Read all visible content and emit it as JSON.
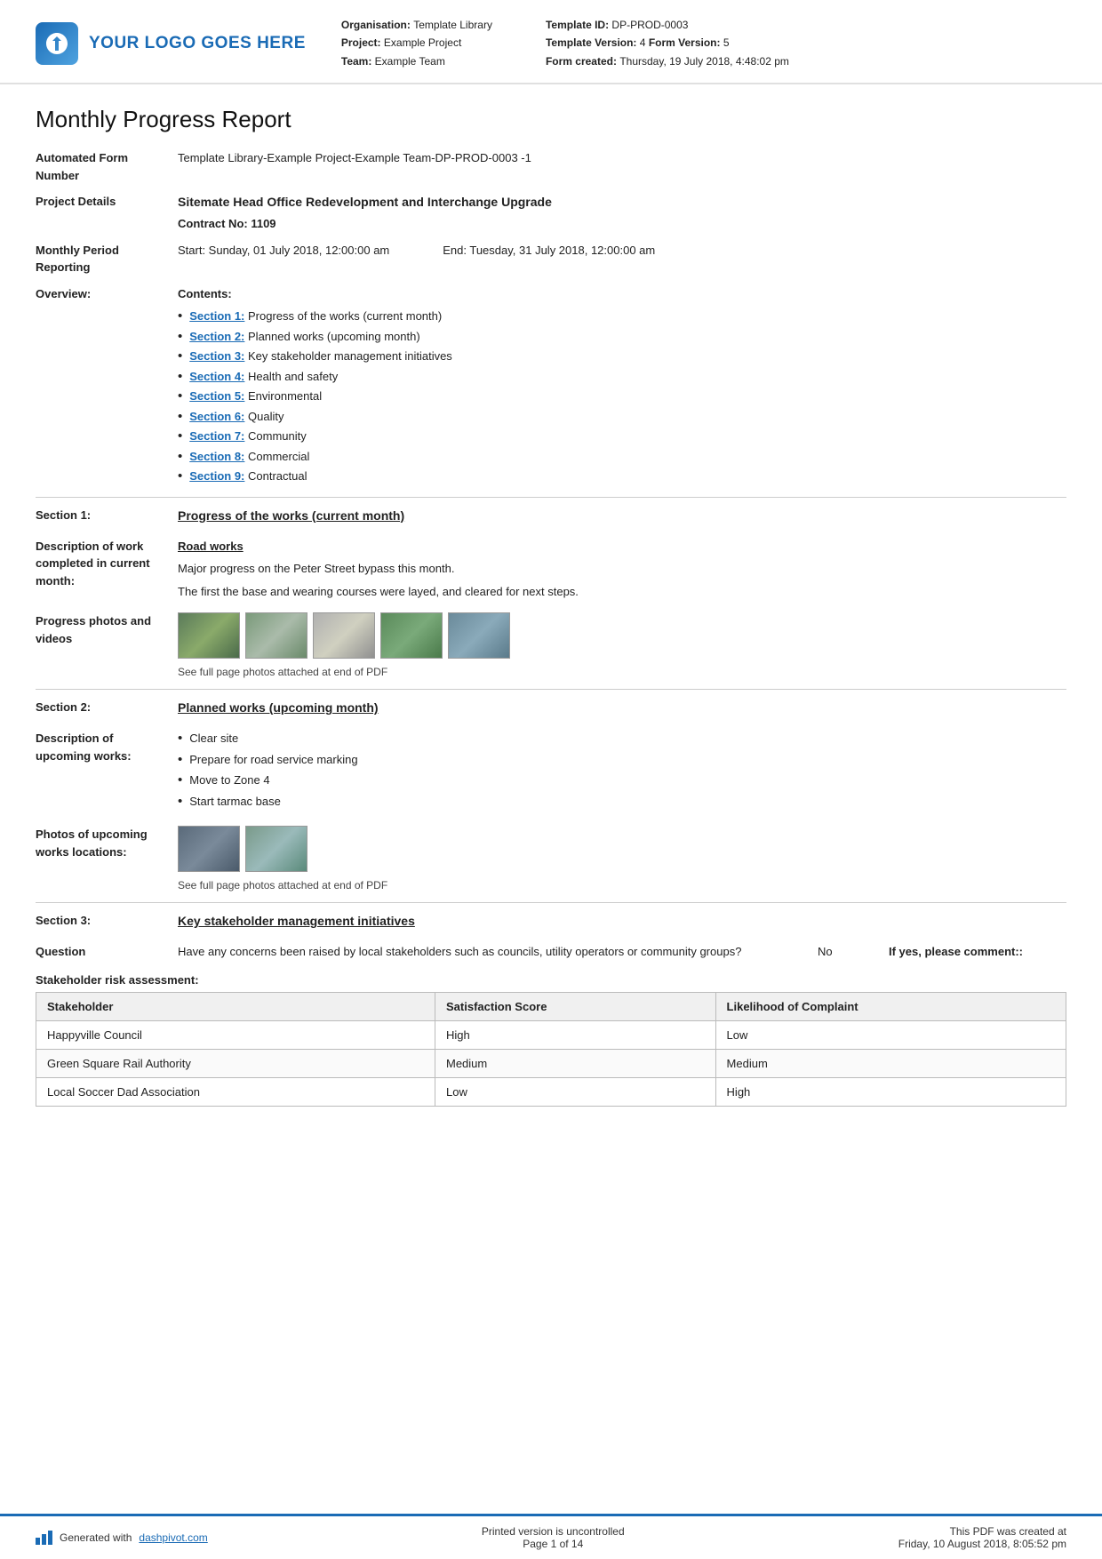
{
  "header": {
    "logo_text": "YOUR LOGO GOES HERE",
    "org_label": "Organisation:",
    "org_value": "Template Library",
    "project_label": "Project:",
    "project_value": "Example Project",
    "team_label": "Team:",
    "team_value": "Example Team",
    "template_id_label": "Template ID:",
    "template_id_value": "DP-PROD-0003",
    "template_version_label": "Template Version:",
    "template_version_value": "4",
    "form_version_label": "Form Version:",
    "form_version_value": "5",
    "form_created_label": "Form created:",
    "form_created_value": "Thursday, 19 July 2018, 4:48:02 pm"
  },
  "report": {
    "title": "Monthly Progress Report",
    "automated_form_label": "Automated Form Number",
    "automated_form_value": "Template Library-Example Project-Example Team-DP-PROD-0003   -1",
    "project_details_label": "Project Details",
    "project_details_value": "Sitemate Head Office Redevelopment and Interchange Upgrade",
    "contract_no": "Contract No: 1109",
    "monthly_period_label": "Monthly Period Reporting",
    "period_start": "Start: Sunday, 01 July 2018, 12:00:00 am",
    "period_end": "End: Tuesday, 31 July 2018, 12:00:00 am",
    "overview_label": "Overview:",
    "contents_label": "Contents:"
  },
  "contents": {
    "items": [
      {
        "id": "Section 1",
        "text": "Progress of the works (current month)"
      },
      {
        "id": "Section 2",
        "text": "Planned works (upcoming month)"
      },
      {
        "id": "Section 3",
        "text": "Key stakeholder management initiatives"
      },
      {
        "id": "Section 4",
        "text": "Health and safety"
      },
      {
        "id": "Section 5",
        "text": "Environmental"
      },
      {
        "id": "Section 6",
        "text": "Quality"
      },
      {
        "id": "Section 7",
        "text": "Community"
      },
      {
        "id": "Section 8",
        "text": "Commercial"
      },
      {
        "id": "Section 9",
        "text": "Contractual"
      }
    ]
  },
  "section1": {
    "label": "Section 1:",
    "heading": "Progress of the works (current month)",
    "work_desc_label": "Description of work completed in current month:",
    "work_type": "Road works",
    "work_desc_1": "Major progress on the Peter Street bypass this month.",
    "work_desc_2": "The first the base and wearing courses were layed, and cleared for next steps.",
    "photos_label": "Progress photos and videos",
    "photos_note": "See full page photos attached at end of PDF"
  },
  "section2": {
    "label": "Section 2:",
    "heading": "Planned works (upcoming month)",
    "desc_label": "Description of upcoming works:",
    "works": [
      "Clear site",
      "Prepare for road service marking",
      "Move to Zone 4",
      "Start tarmac base"
    ],
    "photos_label": "Photos of upcoming works locations:",
    "photos_note": "See full page photos attached at end of PDF"
  },
  "section3": {
    "label": "Section 3:",
    "heading": "Key stakeholder management initiatives",
    "question_label": "Question",
    "question_text": "Have any concerns been raised by local stakeholders such as councils, utility operators or community groups?",
    "question_answer": "No",
    "question_comment_label": "If yes, please comment::"
  },
  "stakeholder_table": {
    "title": "Stakeholder risk assessment:",
    "columns": [
      "Stakeholder",
      "Satisfaction Score",
      "Likelihood of Complaint"
    ],
    "rows": [
      [
        "Happyville Council",
        "High",
        "Low"
      ],
      [
        "Green Square Rail Authority",
        "Medium",
        "Medium"
      ],
      [
        "Local Soccer Dad Association",
        "Low",
        "High"
      ]
    ]
  },
  "footer": {
    "generated_text": "Generated with",
    "generated_link": "dashpivot.com",
    "print_line1": "Printed version is uncontrolled",
    "print_line2": "Page 1 of 14",
    "pdf_line1": "This PDF was created at",
    "pdf_line2": "Friday, 10 August 2018, 8:05:52 pm"
  }
}
